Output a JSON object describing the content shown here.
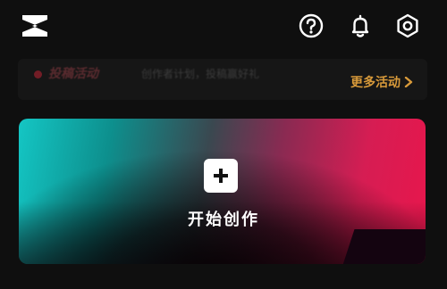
{
  "topbar": {
    "logo_icon": "capcut-logo-icon",
    "icons": [
      "help-icon",
      "bell-icon",
      "settings-icon"
    ]
  },
  "banner": {
    "title": "投稿活动",
    "subtitle": "创作者计划，投稿赢好礼",
    "more_label": "更多活动",
    "more_chevron": "›"
  },
  "create_card": {
    "label": "开始创作",
    "icon": "plus-icon"
  },
  "colors": {
    "background": "#0f0f0f",
    "accent_orange": "#d89a3a",
    "gradient_teal": "#14c6c4",
    "gradient_red": "#e8164c"
  }
}
